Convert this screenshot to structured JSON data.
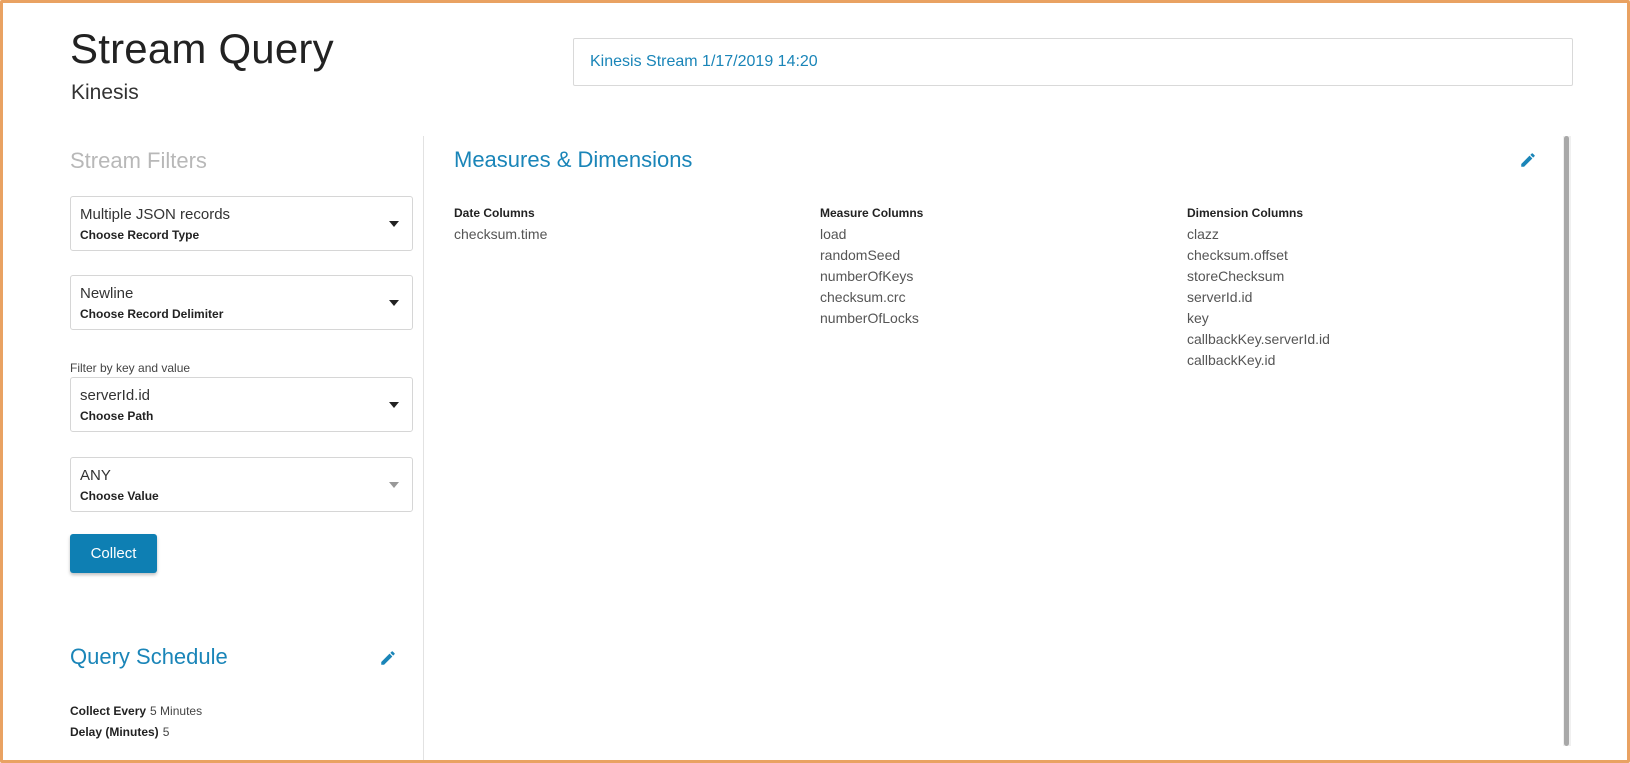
{
  "header": {
    "title": "Stream Query",
    "subtitle": "Kinesis",
    "stream_name": "Kinesis Stream 1/17/2019 14:20"
  },
  "filters": {
    "title": "Stream Filters",
    "record_type": {
      "value": "Multiple JSON records",
      "label": "Choose Record Type"
    },
    "record_delimiter": {
      "value": "Newline",
      "label": "Choose Record Delimiter"
    },
    "filter_caption": "Filter by key and value",
    "path": {
      "value": "serverId.id",
      "label": "Choose Path"
    },
    "value": {
      "value": "ANY",
      "label": "Choose Value"
    },
    "collect_label": "Collect"
  },
  "schedule": {
    "title": "Query Schedule",
    "collect_every_label": "Collect Every",
    "collect_every_value": "5 Minutes",
    "delay_label": "Delay (Minutes)",
    "delay_value": "5"
  },
  "measures": {
    "title": "Measures & Dimensions",
    "date_columns": {
      "header": "Date Columns",
      "items": [
        "checksum.time"
      ]
    },
    "measure_columns": {
      "header": "Measure Columns",
      "items": [
        "load",
        "randomSeed",
        "numberOfKeys",
        "checksum.crc",
        "numberOfLocks"
      ]
    },
    "dimension_columns": {
      "header": "Dimension Columns",
      "items": [
        "clazz",
        "checksum.offset",
        "storeChecksum",
        "serverId.id",
        "key",
        "callbackKey.serverId.id",
        "callbackKey.id"
      ]
    }
  },
  "colors": {
    "accent": "#1a85b8",
    "button": "#0e7fb3",
    "frame": "#e9a262"
  },
  "icons": {
    "edit": "pencil-icon",
    "dropdown": "caret-down-icon"
  }
}
